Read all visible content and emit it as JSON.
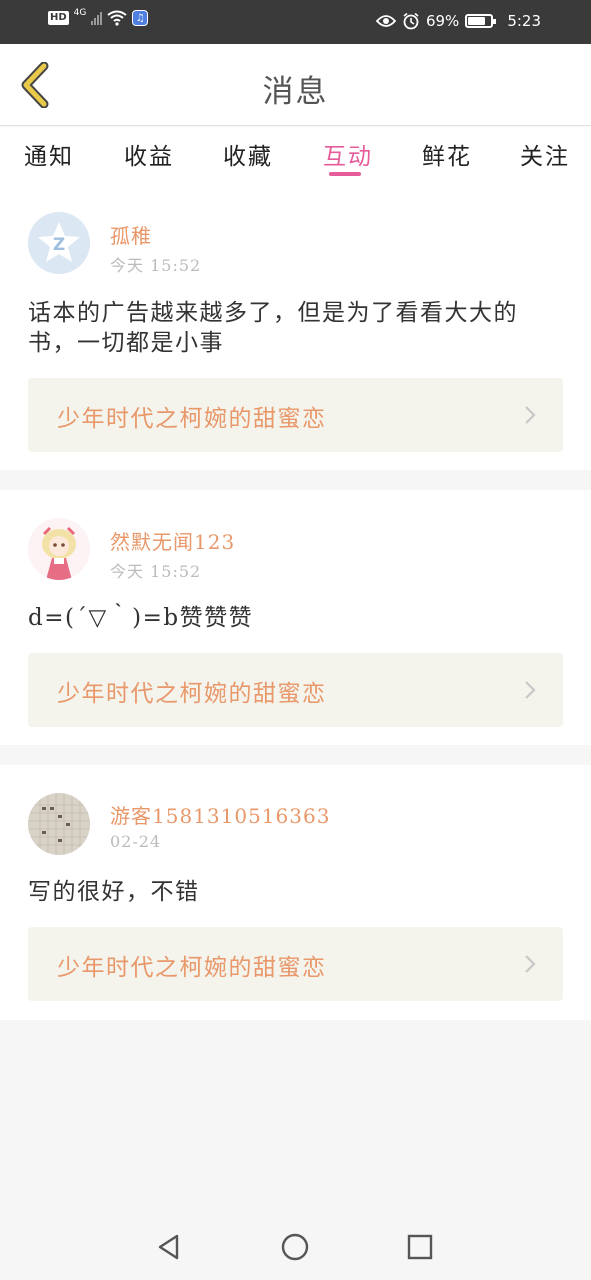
{
  "status_bar": {
    "hd": "HD",
    "network": "4G",
    "battery": "69%",
    "battery_level": 0.69,
    "time": "5:23",
    "icons": [
      "signal-icon",
      "wifi-icon",
      "music-app-icon",
      "eye-icon",
      "alarm-icon",
      "battery-icon"
    ]
  },
  "header": {
    "title": "消息",
    "back_icon": "chevron-left-icon"
  },
  "tabs": [
    {
      "label": "通知"
    },
    {
      "label": "收益"
    },
    {
      "label": "收藏"
    },
    {
      "label": "互动",
      "active": true
    },
    {
      "label": "鲜花"
    },
    {
      "label": "关注"
    }
  ],
  "messages": [
    {
      "user": "孤稚",
      "time": "今天 15:52",
      "content": "话本的广告越来越多了，但是为了看看大大的书，一切都是小事",
      "book": "少年时代之柯婉的甜蜜恋",
      "avatar": "default-avatar-icon"
    },
    {
      "user": "然默无闻123",
      "time": "今天 15:52",
      "content": "d=(´▽｀)=b赞赞赞",
      "book": "少年时代之柯婉的甜蜜恋",
      "avatar": "anime-girl-avatar"
    },
    {
      "user": "游客1581310516363",
      "time": "02-24",
      "content": "写的很好，不错",
      "book": "少年时代之柯婉的甜蜜恋",
      "avatar": "notebook-photo-avatar"
    }
  ],
  "colors": {
    "accent": "#e65c9a",
    "username": "#e8986a",
    "status_bar": "#3a3a3a",
    "book_bg": "#f4f3ec",
    "back_icon": "#e8c94a"
  },
  "nav": [
    "back-triangle-icon",
    "home-circle-icon",
    "recents-square-icon"
  ]
}
